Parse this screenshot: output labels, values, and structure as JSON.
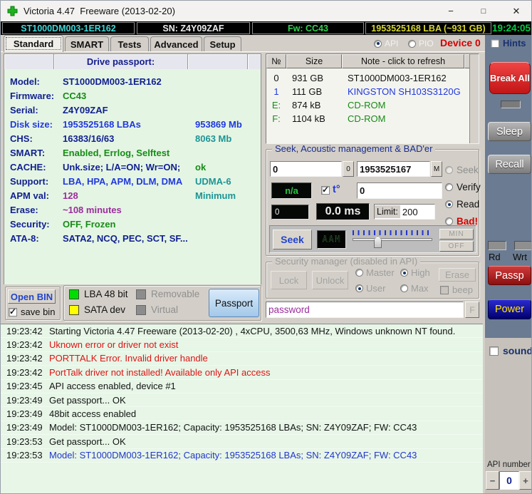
{
  "titlebar": {
    "title": "Victoria 4.47  Freeware (2013-02-20)",
    "minimize": "−",
    "maximize": "□",
    "close": "✕"
  },
  "statusbar": {
    "model": "ST1000DM003-1ER162",
    "serial": "SN: Z4Y09ZAF",
    "firmware": "Fw: CC43",
    "capacity": "1953525168 LBA (~931 GB)",
    "time": "19:24:05"
  },
  "tabs": {
    "standard": "Standard",
    "smart": "SMART",
    "tests": "Tests",
    "advanced": "Advanced",
    "setup": "Setup"
  },
  "mode": {
    "api": "API",
    "pio": "PIO",
    "device": "Device 0",
    "hints": "Hints"
  },
  "passport": {
    "header": "Drive passport:",
    "rows": [
      {
        "label": "Model:",
        "value": "ST1000DM003-1ER162",
        "extra": ""
      },
      {
        "label": "Firmware:",
        "value": "CC43",
        "extra": ""
      },
      {
        "label": "Serial:",
        "value": "Z4Y09ZAF",
        "extra": ""
      },
      {
        "label": "Disk size:",
        "value": "1953525168 LBAs",
        "extra": "953869 Mb"
      },
      {
        "label": "CHS:",
        "value": "16383/16/63",
        "extra": "8063 Mb"
      },
      {
        "label": "SMART:",
        "value": "Enabled, Errlog, Selftest",
        "extra": ""
      },
      {
        "label": "CACHE:",
        "value": "Unk.size; L/A=ON; Wr=ON;",
        "extra": "ok"
      },
      {
        "label": "Support:",
        "value": "LBA, HPA, APM, DLM, DMA",
        "extra": "UDMA-6"
      },
      {
        "label": "APM val:",
        "value": "128",
        "extra": "Minimum"
      },
      {
        "label": "Erase:",
        "value": "~108 minutes",
        "extra": ""
      },
      {
        "label": "Security:",
        "value": "OFF, Frozen",
        "extra": ""
      },
      {
        "label": "ATA-8:",
        "value": "SATA2, NCQ, PEC, SCT, SF...",
        "extra": ""
      }
    ]
  },
  "bin_controls": {
    "open_bin": "Open BIN",
    "save_bin": "save bin",
    "lba48": "LBA 48 bit",
    "sata": "SATA dev",
    "removable": "Removable",
    "virtual": "Virtual",
    "passport_button": "Passport",
    "lba48_color": "#00dd00",
    "sata_color": "#ffff00",
    "disabled_swatch_color": "#8c8c8c"
  },
  "drive_table": {
    "header_num": "№",
    "header_size": "Size",
    "header_note": "Note - click to refresh",
    "rows": [
      {
        "num": "0",
        "size": "931 GB",
        "note": "ST1000DM003-1ER162"
      },
      {
        "num": "1",
        "size": "111 GB",
        "note": "KINGSTON SH103S3120G"
      },
      {
        "num": "E:",
        "size": "874 kB",
        "note": "CD-ROM"
      },
      {
        "num": "F:",
        "size": "1104 kB",
        "note": "CD-ROM"
      }
    ]
  },
  "seek_panel": {
    "title": "Seek, Acoustic management & BAD'er",
    "start_lba": "0",
    "start_button": "0",
    "end_lba": "1953525167",
    "end_button": "M",
    "radio_seek": "Seek",
    "radio_verify": "Verify",
    "radio_read": "Read",
    "radio_bad": "Bad!",
    "na_display": "n/a",
    "temp_label": "t°",
    "temp_value": "0",
    "counter": "0",
    "ms_display": "0.0 ms",
    "limit_label": "Limit:",
    "limit_value": "200",
    "seek_button": "Seek",
    "aam_display": "AAM",
    "min_button": "MIN",
    "off_button": "OFF"
  },
  "security_panel": {
    "title": "Security manager (disabled in API)",
    "lock": "Lock",
    "unlock": "Unlock",
    "master": "Master",
    "user": "User",
    "high": "High",
    "max": "Max",
    "erase": "Erase",
    "beep": "beep",
    "password": "password",
    "f_button": "F"
  },
  "sidebar": {
    "break_all": "Break All",
    "sleep": "Sleep",
    "recall": "Recall",
    "rd": "Rd",
    "wrt": "Wrt",
    "passp": "Passp",
    "power": "Power",
    "sound": "sound",
    "api_number_label": "API number",
    "api_number_value": "0",
    "minus": "−",
    "plus": "+"
  },
  "log": {
    "entries": [
      {
        "time": "19:23:42",
        "text": "Starting Victoria 4.47  Freeware (2013-02-20) , 4xCPU, 3500,63 MHz, Windows unknown NT found.",
        "status": "normal"
      },
      {
        "time": "19:23:42",
        "text": "Uknown error or driver not exist",
        "status": "error"
      },
      {
        "time": "19:23:42",
        "text": "PORTTALK Error. Invalid driver handle",
        "status": "error"
      },
      {
        "time": "19:23:42",
        "text": "PortTalk driver not installed! Available only API access",
        "status": "error"
      },
      {
        "time": "19:23:45",
        "text": "API access enabled, device #1",
        "status": "normal"
      },
      {
        "time": "19:23:49",
        "text": "Get passport... OK",
        "status": "normal"
      },
      {
        "time": "19:23:49",
        "text": "48bit access enabled",
        "status": "normal"
      },
      {
        "time": "19:23:49",
        "text": "Model: ST1000DM003-1ER162; Capacity: 1953525168 LBAs; SN: Z4Y09ZAF; FW: CC43",
        "status": "normal"
      },
      {
        "time": "19:23:53",
        "text": "Get passport... OK",
        "status": "normal"
      },
      {
        "time": "19:23:53",
        "text": "Model: ST1000DM003-1ER162; Capacity: 1953525168 LBAs; SN: Z4Y09ZAF; FW: CC43",
        "status": "info"
      }
    ]
  },
  "colors": {
    "sidebar_bg": "#6b7b91",
    "passport_bg": "#e4f5e4",
    "log_bg": "#e7f6e7",
    "break_all_red": "#d81e1e",
    "power_blue": "#00008b",
    "power_text": "#ffe400",
    "device_red": "#d40000"
  }
}
